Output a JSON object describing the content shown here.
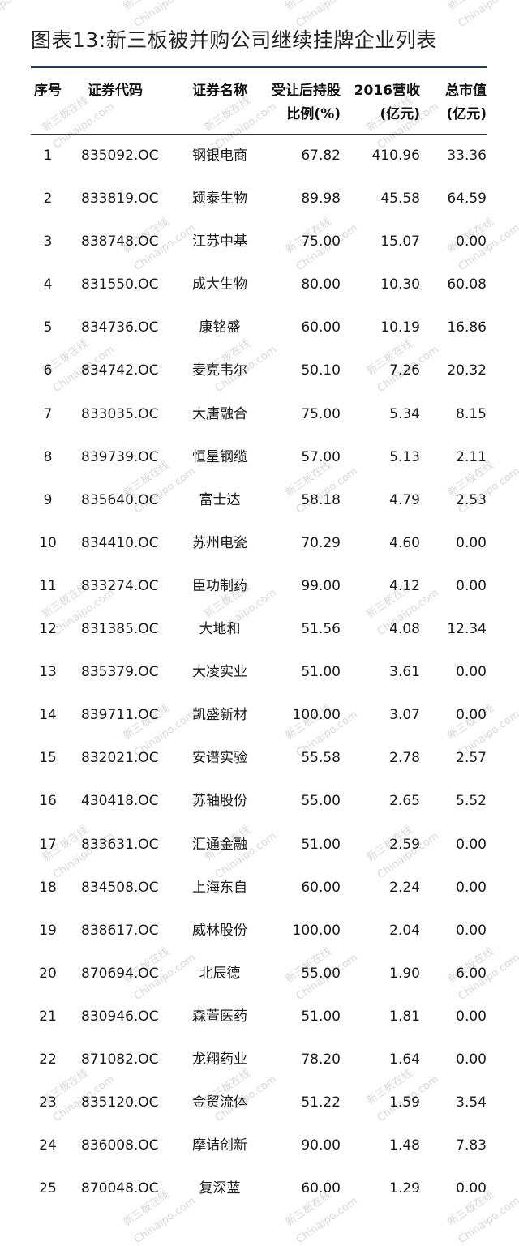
{
  "title": "图表13:新三板被并购公司继续挂牌企业列表",
  "watermark": {
    "cn": "新三板在线",
    "en": "Chinaipo.com"
  },
  "header": {
    "index": "序号",
    "code": "证券代码",
    "name": "证券名称",
    "ratio_line1": "受让后持股",
    "ratio_line2": "比例(%)",
    "revenue_line1": "2016营收",
    "revenue_line2": "(亿元)",
    "cap_line1": "总市值",
    "cap_line2": "(亿元)"
  },
  "rows": [
    {
      "idx": "1",
      "code": "835092.OC",
      "name": "钢银电商",
      "ratio": "67.82",
      "revenue": "410.96",
      "cap": "33.36"
    },
    {
      "idx": "2",
      "code": "833819.OC",
      "name": "颖泰生物",
      "ratio": "89.98",
      "revenue": "45.58",
      "cap": "64.59"
    },
    {
      "idx": "3",
      "code": "838748.OC",
      "name": "江苏中基",
      "ratio": "75.00",
      "revenue": "15.07",
      "cap": "0.00"
    },
    {
      "idx": "4",
      "code": "831550.OC",
      "name": "成大生物",
      "ratio": "80.00",
      "revenue": "10.30",
      "cap": "60.08"
    },
    {
      "idx": "5",
      "code": "834736.OC",
      "name": "康铭盛",
      "ratio": "60.00",
      "revenue": "10.19",
      "cap": "16.86"
    },
    {
      "idx": "6",
      "code": "834742.OC",
      "name": "麦克韦尔",
      "ratio": "50.10",
      "revenue": "7.26",
      "cap": "20.32"
    },
    {
      "idx": "7",
      "code": "833035.OC",
      "name": "大唐融合",
      "ratio": "75.00",
      "revenue": "5.34",
      "cap": "8.15"
    },
    {
      "idx": "8",
      "code": "839739.OC",
      "name": "恒星钢缆",
      "ratio": "57.00",
      "revenue": "5.13",
      "cap": "2.11"
    },
    {
      "idx": "9",
      "code": "835640.OC",
      "name": "富士达",
      "ratio": "58.18",
      "revenue": "4.79",
      "cap": "2.53"
    },
    {
      "idx": "10",
      "code": "834410.OC",
      "name": "苏州电瓷",
      "ratio": "70.29",
      "revenue": "4.60",
      "cap": "0.00"
    },
    {
      "idx": "11",
      "code": "833274.OC",
      "name": "臣功制药",
      "ratio": "99.00",
      "revenue": "4.12",
      "cap": "0.00"
    },
    {
      "idx": "12",
      "code": "831385.OC",
      "name": "大地和",
      "ratio": "51.56",
      "revenue": "4.08",
      "cap": "12.34"
    },
    {
      "idx": "13",
      "code": "835379.OC",
      "name": "大凌实业",
      "ratio": "51.00",
      "revenue": "3.61",
      "cap": "0.00"
    },
    {
      "idx": "14",
      "code": "839711.OC",
      "name": "凯盛新材",
      "ratio": "100.00",
      "revenue": "3.07",
      "cap": "0.00"
    },
    {
      "idx": "15",
      "code": "832021.OC",
      "name": "安谱实验",
      "ratio": "55.58",
      "revenue": "2.78",
      "cap": "2.57"
    },
    {
      "idx": "16",
      "code": "430418.OC",
      "name": "苏轴股份",
      "ratio": "55.00",
      "revenue": "2.65",
      "cap": "5.52"
    },
    {
      "idx": "17",
      "code": "833631.OC",
      "name": "汇通金融",
      "ratio": "51.00",
      "revenue": "2.59",
      "cap": "0.00"
    },
    {
      "idx": "18",
      "code": "834508.OC",
      "name": "上海东自",
      "ratio": "60.00",
      "revenue": "2.24",
      "cap": "0.00"
    },
    {
      "idx": "19",
      "code": "838617.OC",
      "name": "威林股份",
      "ratio": "100.00",
      "revenue": "2.04",
      "cap": "0.00"
    },
    {
      "idx": "20",
      "code": "870694.OC",
      "name": "北辰德",
      "ratio": "55.00",
      "revenue": "1.90",
      "cap": "6.00"
    },
    {
      "idx": "21",
      "code": "830946.OC",
      "name": "森萱医药",
      "ratio": "51.00",
      "revenue": "1.81",
      "cap": "0.00"
    },
    {
      "idx": "22",
      "code": "871082.OC",
      "name": "龙翔药业",
      "ratio": "78.20",
      "revenue": "1.64",
      "cap": "0.00"
    },
    {
      "idx": "23",
      "code": "835120.OC",
      "name": "金贸流体",
      "ratio": "51.22",
      "revenue": "1.59",
      "cap": "3.54"
    },
    {
      "idx": "24",
      "code": "836008.OC",
      "name": "摩诘创新",
      "ratio": "90.00",
      "revenue": "1.48",
      "cap": "7.83"
    },
    {
      "idx": "25",
      "code": "870048.OC",
      "name": "复深蓝",
      "ratio": "60.00",
      "revenue": "1.29",
      "cap": "0.00"
    }
  ]
}
